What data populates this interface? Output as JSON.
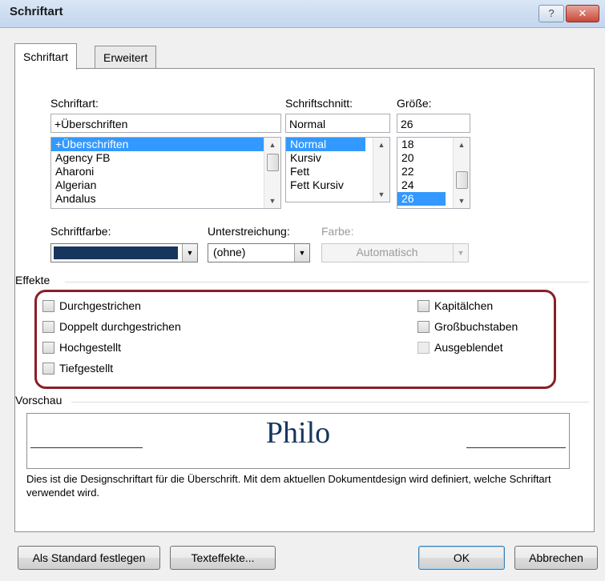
{
  "window": {
    "title": "Schriftart",
    "help_glyph": "?",
    "close_glyph": "✕"
  },
  "tabs": [
    {
      "label": "Schriftart",
      "active": true
    },
    {
      "label": "Erweitert",
      "active": false
    }
  ],
  "font": {
    "label": "Schriftart:",
    "value": "+Überschriften",
    "items": [
      "+Überschriften",
      "Agency FB",
      "Aharoni",
      "Algerian",
      "Andalus"
    ],
    "selected_index": 0
  },
  "style": {
    "label": "Schriftschnitt:",
    "value": "Normal",
    "items": [
      "Normal",
      "Kursiv",
      "Fett",
      "Fett Kursiv"
    ],
    "selected_index": 0
  },
  "size": {
    "label": "Größe:",
    "value": "26",
    "items": [
      "18",
      "20",
      "22",
      "24",
      "26"
    ],
    "selected_index": 4
  },
  "font_color": {
    "label": "Schriftfarbe:",
    "swatch": "#17365d"
  },
  "underline": {
    "label": "Unterstreichung:",
    "value": "(ohne)"
  },
  "underline_color": {
    "label": "Farbe:",
    "value": "Automatisch"
  },
  "effects": {
    "heading": "Effekte",
    "left": [
      "Durchgestrichen",
      "Doppelt durchgestrichen",
      "Hochgestellt",
      "Tiefgestellt"
    ],
    "right": [
      "Kapitälchen",
      "Großbuchstaben",
      "Ausgeblendet"
    ]
  },
  "preview": {
    "heading": "Vorschau",
    "sample": "Philo",
    "description": "Dies ist die Designschriftart für die Überschrift. Mit dem aktuellen Dokumentdesign wird definiert, welche Schriftart verwendet wird."
  },
  "buttons": {
    "set_default": "Als Standard festlegen",
    "text_effects": "Texteffekte...",
    "ok": "OK",
    "cancel": "Abbrechen"
  },
  "colors": {
    "selection": "#3399ff",
    "effects_highlight": "#8a1f26"
  },
  "icons": {
    "up": "scroll-up-icon",
    "down": "scroll-down-icon",
    "dropdown": "chevron-down-icon"
  }
}
